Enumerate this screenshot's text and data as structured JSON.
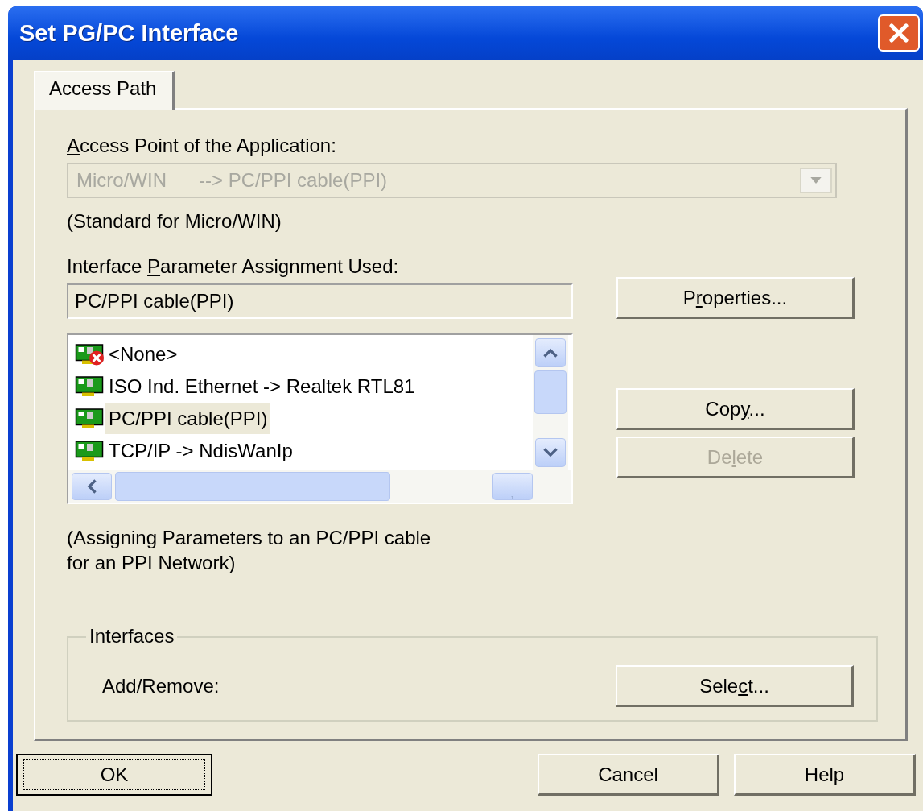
{
  "window": {
    "title": "Set PG/PC Interface"
  },
  "tabs": [
    {
      "label": "Access Path",
      "selected": true
    }
  ],
  "access_point": {
    "label": {
      "key": "A",
      "post": "ccess Point of the Application:"
    },
    "value": "Micro/WIN      --> PC/PPI cable(PPI)",
    "disabled": true,
    "note": "(Standard for Micro/WIN)"
  },
  "parameter_assignment": {
    "label": {
      "pre": "Interface ",
      "key": "P",
      "post": "arameter Assignment Used:"
    },
    "value": "PC/PPI cable(PPI)",
    "items": [
      {
        "label": "<None>",
        "kind": "none",
        "selected": false
      },
      {
        "label": "ISO Ind. Ethernet -> Realtek RTL81",
        "kind": "card",
        "selected": false
      },
      {
        "label": "PC/PPI cable(PPI)",
        "kind": "card",
        "selected": true
      },
      {
        "label": "TCP/IP -> NdisWanIp",
        "kind": "card",
        "selected": false
      }
    ],
    "description": [
      "(Assigning Parameters to an PC/PPI cable",
      "for an PPI Network)"
    ]
  },
  "side_buttons": [
    {
      "label": {
        "pre": "P",
        "key": "r",
        "post": "operties..."
      },
      "disabled": false
    },
    {
      "label": {
        "pre": "Cop",
        "key": "y",
        "post": "..."
      },
      "disabled": false
    },
    {
      "label": {
        "pre": "De",
        "key": "l",
        "post": "ete"
      },
      "disabled": true
    }
  ],
  "interfaces": {
    "title": "Interfaces",
    "label": "Add/Remove:",
    "button": {
      "pre": "Sele",
      "key": "c",
      "post": "t..."
    }
  },
  "buttons": [
    {
      "label": "OK",
      "default": true
    },
    {
      "label": "Cancel",
      "default": false
    },
    {
      "label": "Help",
      "default": false
    }
  ]
}
